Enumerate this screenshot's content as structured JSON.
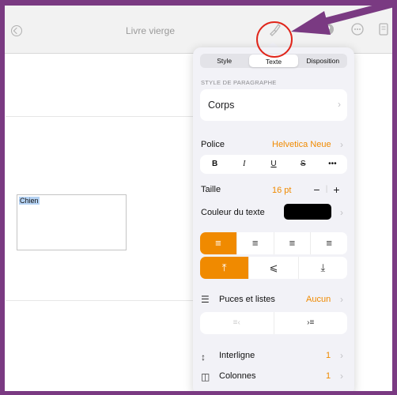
{
  "toolbar": {
    "title": "Livre vierge",
    "icons": [
      "back-icon",
      "format-paintbrush-icon",
      "share-icon",
      "more-icon",
      "document-icon"
    ]
  },
  "document": {
    "textbox_text": "Chien"
  },
  "panel": {
    "tabs": [
      "Style",
      "Texte",
      "Disposition"
    ],
    "active_tab": "Texte",
    "paragraph_style_header": "STYLE DE PARAGRAPHE",
    "paragraph_style": "Corps",
    "font_label": "Police",
    "font_value": "Helvetica Neue",
    "format_buttons": [
      "B",
      "I",
      "U",
      "S",
      "•••"
    ],
    "size_label": "Taille",
    "size_value": "16 pt",
    "stepper_minus": "−",
    "stepper_plus": "+",
    "color_label": "Couleur du texte",
    "text_color": "#000000",
    "bullets_label": "Puces et listes",
    "bullets_value": "Aucun",
    "line_spacing_label": "Interligne",
    "line_spacing_value": "1",
    "columns_label": "Colonnes",
    "columns_value": "1"
  },
  "colors": {
    "accent": "#f08a00",
    "frame": "#7a3a82",
    "highlight": "#e0261b"
  }
}
